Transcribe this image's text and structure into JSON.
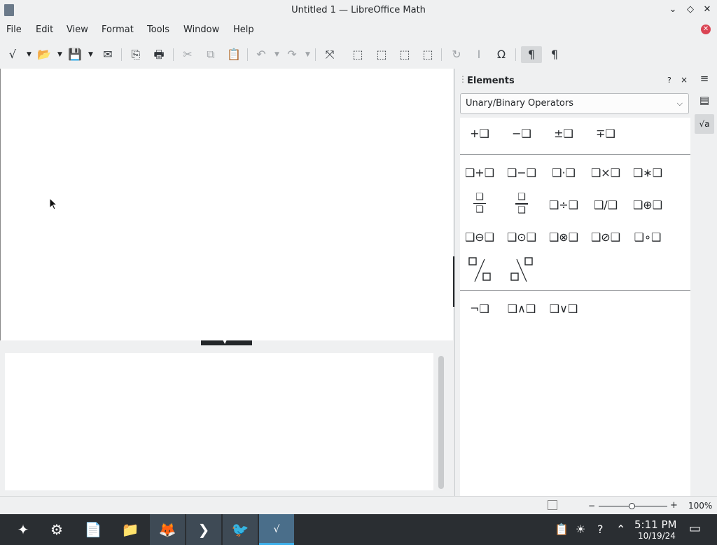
{
  "window": {
    "title": "Untitled 1 — LibreOffice Math",
    "controls": {
      "minimize": "⌄",
      "maximize": "◇",
      "close": "✕"
    }
  },
  "menubar": {
    "items": [
      "File",
      "Edit",
      "View",
      "Format",
      "Tools",
      "Window",
      "Help"
    ],
    "close_document": "✕"
  },
  "toolbar": {
    "formula": "√",
    "open": "📂",
    "save": "💾",
    "export": "✉",
    "edit_doc": "⎘",
    "print": "🖶",
    "cut": "✂",
    "copy": "⧉",
    "paste": "📋",
    "undo": "↶",
    "redo": "↷",
    "zoom_100": "⤧",
    "zoom_in": "⬚",
    "zoom_out": "⬚",
    "show_all": "⬚",
    "update": "⬚",
    "formula_cursor": "↻",
    "cursor_i": "I",
    "symbols": "Ω",
    "ltr": "¶",
    "rtl": "¶"
  },
  "elements_panel": {
    "title": "Elements",
    "help": "?",
    "close": "×",
    "category": "Unary/Binary Operators",
    "unary": [
      "+❑",
      "−❑",
      "±❑",
      "∓❑"
    ],
    "binary_row1": [
      "❑+❑",
      "❑−❑",
      "❑·❑",
      "❑×❑",
      "❑∗❑"
    ],
    "binary_row2": [
      "❑÷❑",
      "❑/❑",
      "❑⊕❑"
    ],
    "binary_row3": [
      "❑⊖❑",
      "❑⊙❑",
      "❑⊗❑",
      "❑⊘❑",
      "❑∘❑"
    ],
    "fraction_symbols": [
      "❑",
      "❑"
    ],
    "logic": [
      "¬❑",
      "❑∧❑",
      "❑∨❑"
    ]
  },
  "sidebar": {
    "menu": "≡",
    "properties": "▤",
    "elements": "√a"
  },
  "statusbar": {
    "zoom": "100%",
    "zoom_minus": "−",
    "zoom_plus": "+"
  },
  "taskbar": {
    "launcher": "✦",
    "system_settings": "⚙",
    "files": "📄",
    "folder": "📁",
    "firefox": "🦊",
    "terminal": "❯",
    "app_bird": "🐦",
    "libreoffice_math": "√",
    "tray_clipboard": "📋",
    "tray_brightness": "☀",
    "tray_help": "?",
    "tray_expand": "⌃",
    "clock_time": "5:11 PM",
    "clock_date": "10/19/24",
    "show_desktop": "▭"
  }
}
